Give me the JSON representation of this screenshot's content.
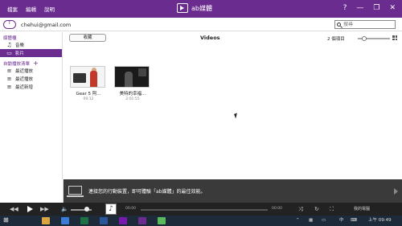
{
  "menu": [
    "檔案",
    "編輯",
    "說明"
  ],
  "app": {
    "title": "ab媒體"
  },
  "window_controls": [
    "?",
    "—",
    "❐",
    "✕"
  ],
  "account": {
    "email": "chehui@gmail.com"
  },
  "search": {
    "placeholder": "搜尋"
  },
  "sidebar": {
    "library_header": "媒體櫃",
    "library_items": [
      {
        "label": "音樂",
        "icon": "music-icon",
        "glyph": "♫"
      },
      {
        "label": "影片",
        "icon": "video-icon",
        "glyph": "▭",
        "active": true
      }
    ],
    "playlists_header": "自動播放清單",
    "playlist_items": [
      {
        "label": "最近播放",
        "icon": "playlist-icon",
        "glyph": "≡"
      },
      {
        "label": "最近播放",
        "icon": "playlist-icon",
        "glyph": "≡"
      },
      {
        "label": "最近新增",
        "icon": "playlist-icon",
        "glyph": "≡"
      }
    ]
  },
  "main": {
    "back_label": "收藏",
    "view_title": "Videos",
    "item_count": "2 個項目",
    "zoom_level": 0.15
  },
  "videos": [
    {
      "title": "Gear 5 阿...",
      "duration": "09:12"
    },
    {
      "title": "美特的幸福...",
      "duration": "2:01:55"
    }
  ],
  "notice": {
    "text": "連接您的行動裝置，即可體驗「ab媒體」的最佳效能。"
  },
  "player": {
    "prev": "◀◀",
    "next": "▶▶",
    "volume": 0.75,
    "time_current": "00:00",
    "time_total": "00:00",
    "progress": 0.0,
    "shuffle": "⤨",
    "repeat": "↻",
    "my_computer": "我的電腦"
  },
  "taskbar": {
    "ime": "中",
    "clock": "上午 09:49",
    "apps": [
      {
        "name": "file-explorer-icon",
        "color": "#d9a441"
      },
      {
        "name": "store-icon",
        "color": "#3a7bd5"
      },
      {
        "name": "excel-icon",
        "color": "#1e7145"
      },
      {
        "name": "word-icon",
        "color": "#2b579a"
      },
      {
        "name": "onenote-icon",
        "color": "#7719aa"
      },
      {
        "name": "ab-media-icon",
        "color": "#6b2c8f"
      },
      {
        "name": "green-app-icon",
        "color": "#5cb85c"
      }
    ]
  }
}
